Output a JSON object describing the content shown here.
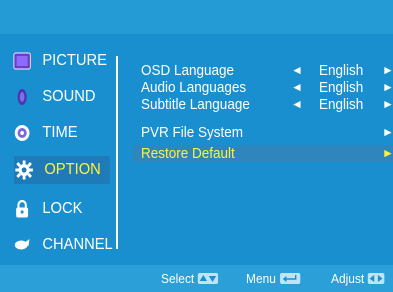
{
  "menu": {
    "items": [
      {
        "label": "PICTURE",
        "icon": "picture-icon"
      },
      {
        "label": "SOUND",
        "icon": "sound-icon"
      },
      {
        "label": "TIME",
        "icon": "time-icon"
      },
      {
        "label": "OPTION",
        "icon": "option-gear-icon",
        "active": true
      },
      {
        "label": "LOCK",
        "icon": "lock-icon"
      },
      {
        "label": "CHANNEL",
        "icon": "channel-icon"
      }
    ]
  },
  "options": [
    {
      "label": "OSD Language",
      "value": "English",
      "left_arrow": "◄",
      "right_arrow": "►"
    },
    {
      "label": "Audio Languages",
      "value": "English",
      "left_arrow": "◄",
      "right_arrow": "►"
    },
    {
      "label": "Subtitle Language",
      "value": "English",
      "left_arrow": "◄",
      "right_arrow": "►"
    },
    {
      "label": "PVR File System",
      "right_arrow": "►"
    },
    {
      "label": "Restore Default",
      "right_arrow": "►",
      "selected": true
    }
  ],
  "footer": {
    "select_label": "Select",
    "menu_label": "Menu",
    "adjust_label": "Adjust"
  },
  "colors": {
    "background": "#2d9ed6",
    "panel": "#1a8fd0",
    "highlight_text": "#fff23a",
    "active_bg": "#1f7bb8"
  }
}
